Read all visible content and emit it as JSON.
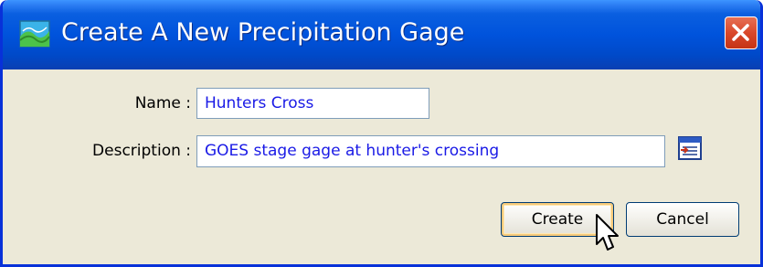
{
  "window": {
    "title": "Create A New Precipitation Gage",
    "title_bar_color": "#0053DC",
    "background_color": "#ECE9D8"
  },
  "icons": {
    "app": "precipitation-gage-icon",
    "close": "close-icon",
    "browse": "browse-icon",
    "cursor": "mouse-pointer-icon"
  },
  "form": {
    "name_label": "Name :",
    "name_value": "Hunters Cross",
    "description_label": "Description :",
    "description_value": "GOES stage gage at hunter's crossing"
  },
  "buttons": {
    "create_label": "Create",
    "cancel_label": "Cancel"
  }
}
